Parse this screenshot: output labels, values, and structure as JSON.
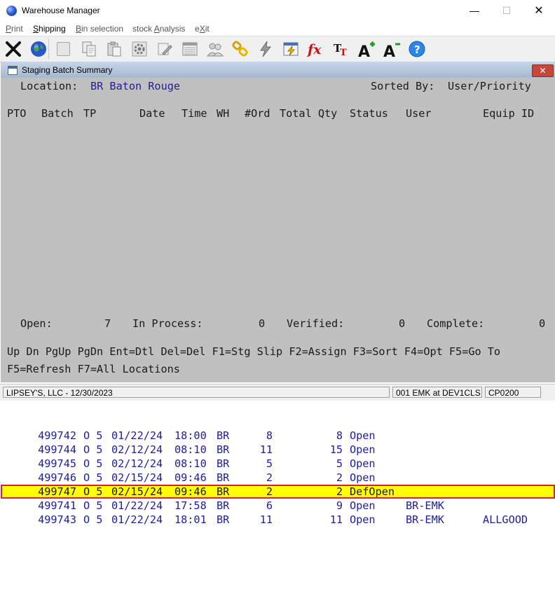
{
  "window": {
    "title": "Warehouse Manager",
    "minimize": "—",
    "maximize": "☐",
    "close": "✕"
  },
  "menu": [
    {
      "label": "Print",
      "key": "P"
    },
    {
      "label": "Shipping",
      "key": "S"
    },
    {
      "label": "Bin selection",
      "key": "B"
    },
    {
      "label": "stock Analysis",
      "key": "A"
    },
    {
      "label": "eXit",
      "key": "X"
    }
  ],
  "toolbar_icons": [
    "close-x-icon",
    "globe-icon",
    "blank-icon",
    "copy-icon",
    "paste-icon",
    "gear-icon",
    "edit-icon",
    "list-icon",
    "users-icon",
    "chain-link-icon",
    "lightning-icon",
    "calendar-lightning-icon",
    "fx-icon",
    "text-format-icon",
    "font-increase-icon",
    "font-decrease-icon",
    "help-icon"
  ],
  "inner_window": {
    "title": "Staging Batch Summary",
    "close": "✕"
  },
  "header": {
    "location_label": "Location:",
    "location_value": "BR Baton Rouge",
    "sorted_label": "Sorted By:",
    "sorted_value": "User/Priority"
  },
  "columns": {
    "pto": "PTO",
    "batch": "Batch",
    "tp": "TP",
    "date": "Date",
    "time": "Time",
    "wh": "WH",
    "ord": "#Ord",
    "qty": "Total Qty",
    "status": "Status",
    "user": "User",
    "equip": "Equip ID"
  },
  "rows": [
    {
      "batch": "499742",
      "tp": "O 5",
      "date": "01/22/24",
      "time": "18:00",
      "wh": "BR",
      "ord": "8",
      "qty": "8",
      "status": "Open",
      "user": "",
      "equip": ""
    },
    {
      "batch": "499744",
      "tp": "O 5",
      "date": "02/12/24",
      "time": "08:10",
      "wh": "BR",
      "ord": "11",
      "qty": "15",
      "status": "Open",
      "user": "",
      "equip": ""
    },
    {
      "batch": "499745",
      "tp": "O 5",
      "date": "02/12/24",
      "time": "08:10",
      "wh": "BR",
      "ord": "5",
      "qty": "5",
      "status": "Open",
      "user": "",
      "equip": ""
    },
    {
      "batch": "499746",
      "tp": "O 5",
      "date": "02/15/24",
      "time": "09:46",
      "wh": "BR",
      "ord": "2",
      "qty": "2",
      "status": "Open",
      "user": "",
      "equip": ""
    },
    {
      "batch": "499747",
      "tp": "O 5",
      "date": "02/15/24",
      "time": "09:46",
      "wh": "BR",
      "ord": "2",
      "qty": "2",
      "status": "DefOpen",
      "user": "",
      "equip": ""
    },
    {
      "batch": "499741",
      "tp": "O 5",
      "date": "01/22/24",
      "time": "17:58",
      "wh": "BR",
      "ord": "6",
      "qty": "9",
      "status": "Open",
      "user": "BR-EMK",
      "equip": ""
    },
    {
      "batch": "499743",
      "tp": "O 5",
      "date": "01/22/24",
      "time": "18:01",
      "wh": "BR",
      "ord": "11",
      "qty": "11",
      "status": "Open",
      "user": "BR-EMK",
      "equip": "ALLGOOD"
    }
  ],
  "selected_row": 4,
  "totals": {
    "open_label": "Open:",
    "open_value": "7",
    "inprocess_label": "In Process:",
    "inprocess_value": "0",
    "verified_label": "Verified:",
    "verified_value": "0",
    "complete_label": "Complete:",
    "complete_value": "0"
  },
  "keys_line1": "Up Dn PgUp PgDn Ent=Dtl Del=Del F1=Stg Slip F2=Assign F3=Sort F4=Opt F5=Go To",
  "keys_line2": "F5=Refresh F7=All Locations",
  "statusbar": {
    "company": "LIPSEY'S, LLC - 12/30/2023",
    "session": "001 EMK at DEV1CLS",
    "program": "CP0200"
  },
  "colors": {
    "terminal_bg": "#c0c0c0",
    "data_text": "#20209a",
    "selected_bg": "#ffff00",
    "selected_border": "#e0202f"
  }
}
